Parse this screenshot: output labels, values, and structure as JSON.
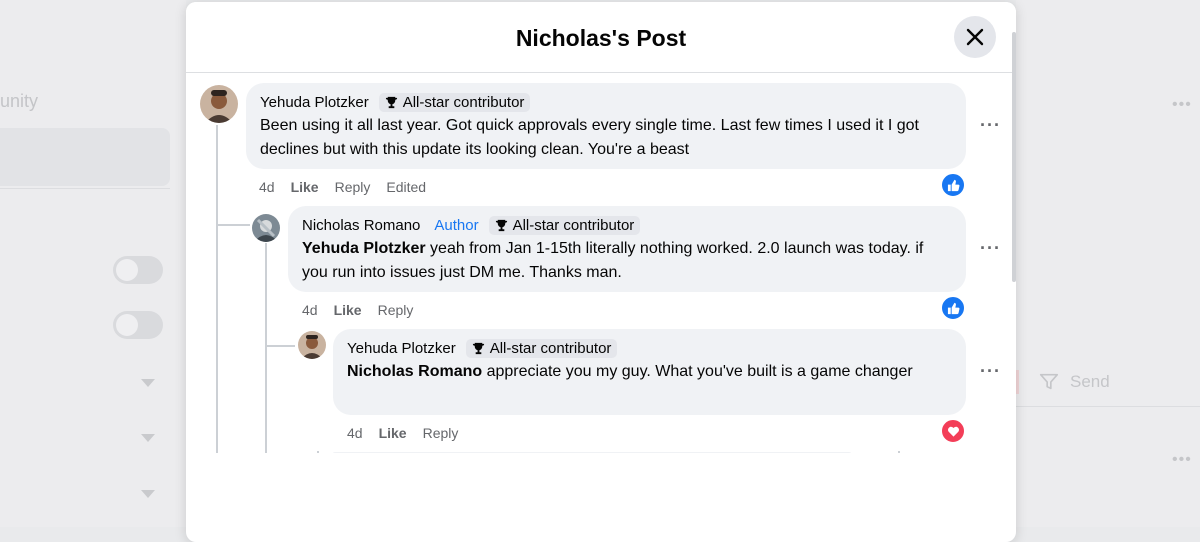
{
  "background": {
    "left_text": "unity",
    "right_send_label": "Send"
  },
  "modal": {
    "title": "Nicholas's Post",
    "close_icon": "close-icon"
  },
  "comments": [
    {
      "author": "Yehuda Plotzker",
      "badge": "All-star contributor",
      "text": "Been using it all last year. Got quick approvals every single time. Last few times I used it I got declines but with this update its looking clean. You're a beast",
      "time": "4d",
      "like": "Like",
      "reply": "Reply",
      "edited": "Edited",
      "reaction": "like"
    },
    {
      "author": "Nicholas Romano",
      "author_tag": "Author",
      "badge": "All-star contributor",
      "mention": "Yehuda Plotzker",
      "text": " yeah from Jan 1-15th literally nothing worked. 2.0 launch was today. if you run into issues just DM me. Thanks man.",
      "time": "4d",
      "like": "Like",
      "reply": "Reply",
      "reaction": "like"
    },
    {
      "author": "Yehuda Plotzker",
      "badge": "All-star contributor",
      "mention": "Nicholas Romano",
      "text": " appreciate you my guy. What you've built is a game changer",
      "time": "4d",
      "like": "Like",
      "reply": "Reply",
      "reaction": "love"
    }
  ],
  "colors": {
    "link_blue": "#1877f2",
    "like_blue": "#1877f2",
    "love_red": "#f33e58",
    "bubble_bg": "#f0f2f5"
  }
}
